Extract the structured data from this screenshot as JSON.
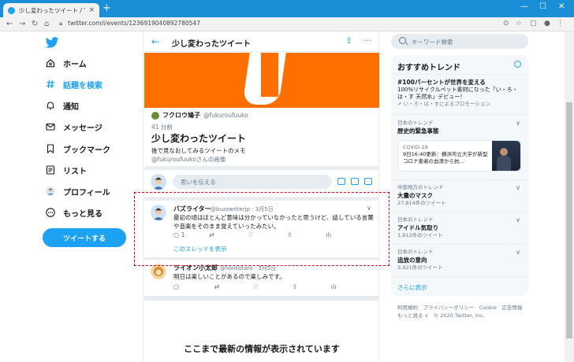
{
  "browser": {
    "tab_title": "少し変わったツイート / Twitter",
    "tab_close": "×",
    "new_tab": "+",
    "url": "twitter.com/i/events/1236919040892780547",
    "minimize": "—",
    "maximize": "☐",
    "close": "✕"
  },
  "nav": {
    "items": [
      {
        "label": "ホーム",
        "icon": "home-icon"
      },
      {
        "label": "話題を検索",
        "icon": "hashtag-icon"
      },
      {
        "label": "通知",
        "icon": "bell-icon"
      },
      {
        "label": "メッセージ",
        "icon": "envelope-icon"
      },
      {
        "label": "ブックマーク",
        "icon": "bookmark-icon"
      },
      {
        "label": "リスト",
        "icon": "list-icon"
      },
      {
        "label": "プロフィール",
        "icon": "avatar-icon"
      },
      {
        "label": "もっと見る",
        "icon": "more-icon"
      }
    ],
    "tweet_button": "ツイートする"
  },
  "event": {
    "header_title": "少し変わったツイート",
    "author_name": "フクロウ鳩子",
    "author_handle": "@fukuroufuuko",
    "time_ago": "41 分前",
    "title": "少し変わったツイート",
    "description": "後で見なおしてみるツイートのメモ",
    "credit": "@fukuroufuukoさんの画像"
  },
  "compose": {
    "placeholder": "思いを伝える"
  },
  "replies": [
    {
      "name": "バズライター",
      "handle": "@buzzwriterjp · 3月5日",
      "text": "最初の頃はほとんど意味は分かっていなかったと思うけど、話している言葉や音楽をそのまま覚えていったみたい。",
      "reply_count": "1",
      "thread_link": "このスレッドを表示"
    },
    {
      "name": "ライオン小太郎",
      "handle": "@lionkotaro · 3月5日",
      "text": "明日は楽しいことがあるので楽しみです。"
    }
  ],
  "end_message": "ここまで最新の情報が表示されています",
  "search": {
    "placeholder": "キーワード検索"
  },
  "trends": {
    "header": "おすすめトレンド",
    "promoted": {
      "title": "#100パーセントが世界を変える",
      "text": "100%リサイクルペット素材になった「い・ろ・は・す 天然水」デビュー！",
      "by": "い・ろ・は・すによるプロモーション"
    },
    "items": [
      {
        "context": "日本のトレンド",
        "name": "歴史的緊急事態",
        "count": ""
      },
      {
        "context": "中部地方のトレンド",
        "name": "大量のマスク",
        "count": "27,814件のツイート"
      },
      {
        "context": "日本のトレンド",
        "name": "アイドル気取り",
        "count": "1,912件のツイート"
      },
      {
        "context": "日本のトレンド",
        "name": "追放の意向",
        "count": "3,921件のツイート"
      }
    ],
    "news": {
      "label": "COVID-19",
      "text": "9日16:40更新：横浜市立大学が新型コロナ患者の血清から抗..."
    },
    "show_more": "さらに表示"
  },
  "footer": {
    "line1": "利用規約　プライバシーポリシー　Cookie　広告情報",
    "line2": "もっと見る ∨　© 2020 Twitter, Inc."
  },
  "colors": {
    "accent": "#1da1f2",
    "banner": "#ff6f00",
    "highlight": "#d0021b",
    "chrome": "#1a8fd8"
  }
}
